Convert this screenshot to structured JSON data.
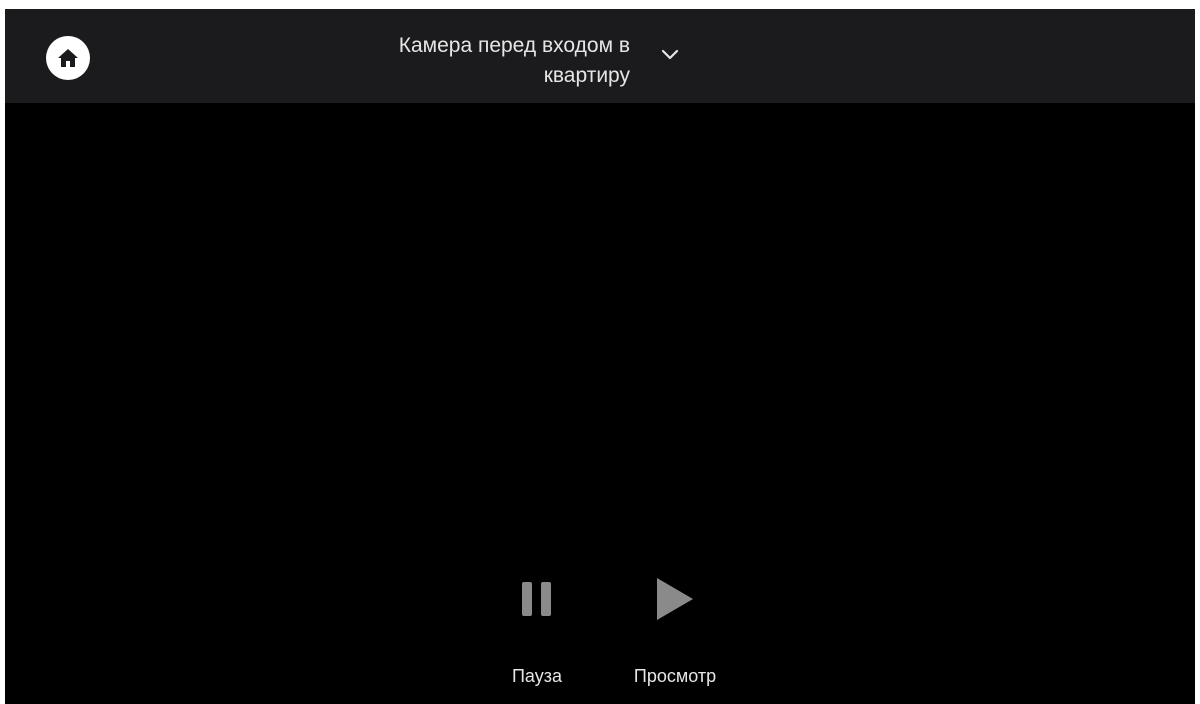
{
  "header": {
    "home_icon": "home-icon",
    "camera_title": "Камера перед входом в\nквартиру",
    "dropdown_icon": "chevron-down-icon"
  },
  "controls": {
    "pause": {
      "icon": "pause-icon",
      "label": "Пауза"
    },
    "play": {
      "icon": "play-icon",
      "label": "Просмотр"
    }
  },
  "colors": {
    "background": "#000000",
    "topbar": "#1b1b1d",
    "text": "#e6e6e6",
    "icon_gray": "#8a8a8a",
    "home_button_bg": "#ffffff"
  }
}
